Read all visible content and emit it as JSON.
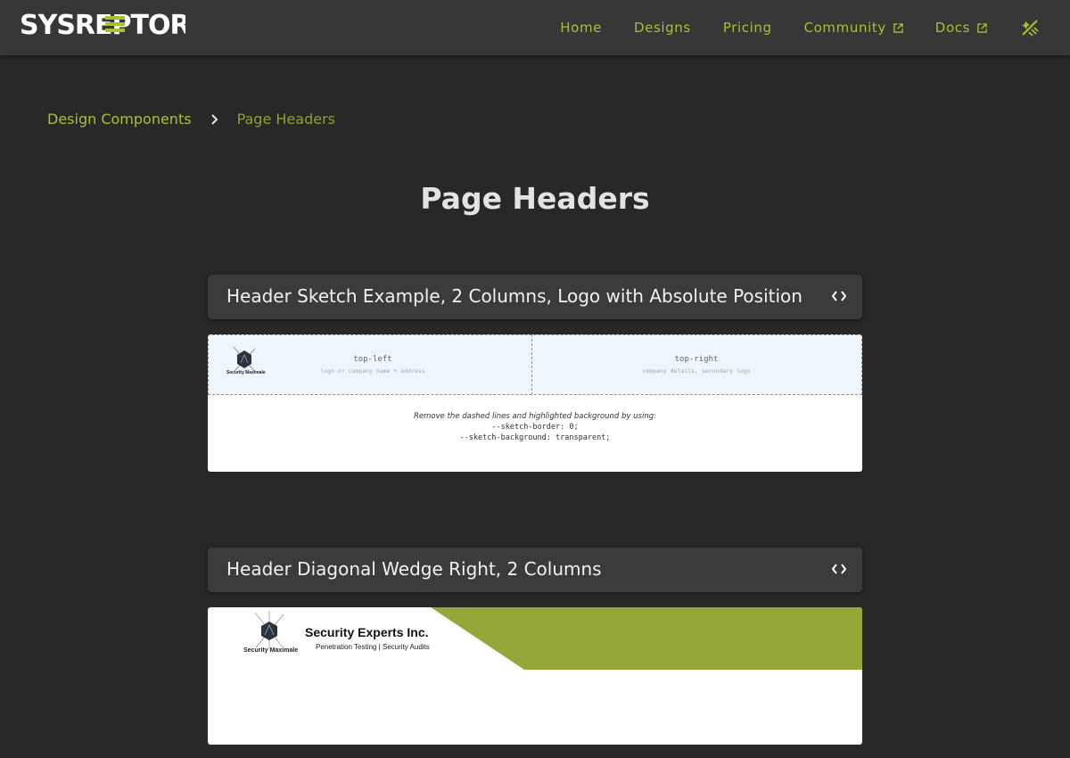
{
  "brand": {
    "name": "SYSREPTOR",
    "accent": "#a5c232",
    "background": "#282828"
  },
  "nav": {
    "items": [
      {
        "label": "Home",
        "external": false
      },
      {
        "label": "Designs",
        "external": false
      },
      {
        "label": "Pricing",
        "external": false
      },
      {
        "label": "Community",
        "external": true
      },
      {
        "label": "Docs",
        "external": true
      }
    ],
    "theme_icon": "theme-toggle-icon"
  },
  "breadcrumb": {
    "parent": "Design Components",
    "current": "Page Headers"
  },
  "page": {
    "title": "Page Headers"
  },
  "sections": [
    {
      "title": "Header Sketch Example, 2 Columns, Logo with Absolute Position",
      "preview": {
        "top_left_label": "top-left",
        "top_left_sub": "logo or company name + address",
        "top_right_label": "top-right",
        "top_right_sub": "company details, secondary logo",
        "logo_text": "Security Maximale",
        "note_line1": "Remove the dashed lines and highlighted background by using:",
        "note_line2": "--sketch-border: 0;",
        "note_line3": "--sketch-background: transparent;"
      }
    },
    {
      "title": "Header Diagonal Wedge Right, 2 Columns",
      "preview": {
        "logo_text": "Security Maximale",
        "company_name": "Security Experts Inc.",
        "company_tagline": "Penetration Testing | Security Audits",
        "wedge_color": "#94a83a"
      }
    }
  ]
}
